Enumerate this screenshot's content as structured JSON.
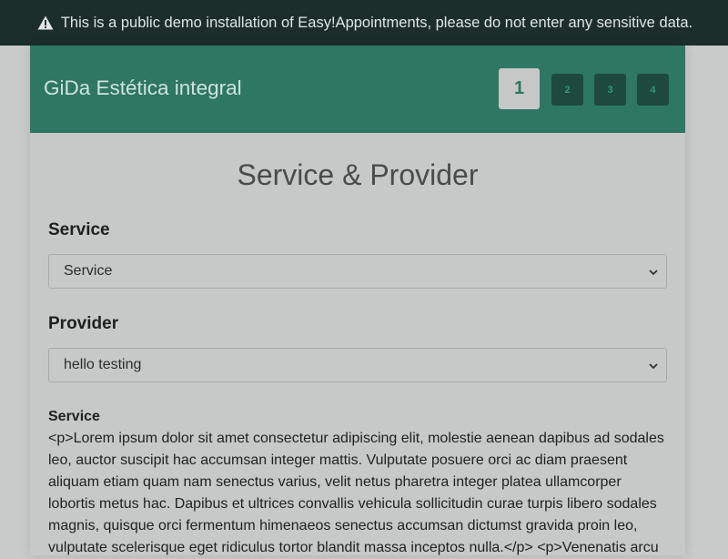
{
  "demo_banner": {
    "icon": "warning-icon",
    "text": "This is a public demo installation of Easy!Appointments, please do not enter any sensitive data."
  },
  "header": {
    "company_name": "GiDa Estética integral",
    "steps": [
      {
        "label": "1",
        "active": true
      },
      {
        "label": "2",
        "active": false
      },
      {
        "label": "3",
        "active": false
      },
      {
        "label": "4",
        "active": false
      }
    ]
  },
  "wizard": {
    "title": "Service & Provider",
    "service_label": "Service",
    "service_selected": "Service",
    "provider_label": "Provider",
    "provider_selected": "hello testing"
  },
  "description": {
    "title": "Service",
    "text": "<p>Lorem ipsum dolor sit amet consectetur adipiscing elit, molestie aenean dapibus ad sodales leo, auctor suscipit hac accumsan integer mattis. Vulputate posuere orci ac diam praesent aliquam etiam quam nam senectus varius, velit netus pharetra integer platea ullamcorper lobortis metus hac. Dapibus et ultrices convallis vehicula sollicitudin curae turpis libero sodales magnis, quisque orci fermentum himenaeos senectus accumsan dictumst gravida proin leo, vulputate scelerisque eget ridiculus tortor blandit massa inceptos nulla.</p> <p>Venenatis arcu"
  },
  "colors": {
    "header_green": "#2e7762",
    "banner_dark": "#1b2e2b",
    "step_inactive": "#1d4a3d"
  }
}
